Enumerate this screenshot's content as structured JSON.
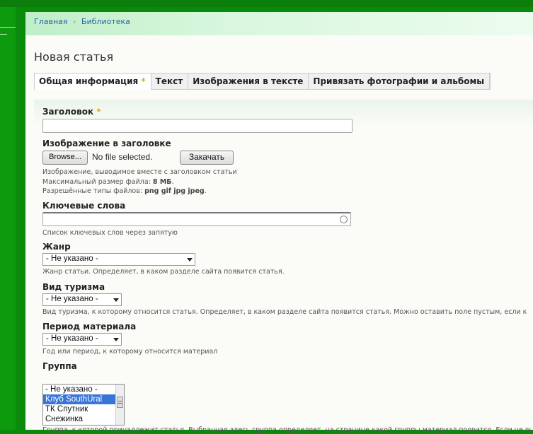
{
  "breadcrumb": [
    "Главная",
    "Библиотека"
  ],
  "breadcrumb_separator": "›",
  "page_title": "Новая статья",
  "tabs": [
    {
      "label": "Общая информация",
      "required": true,
      "active": true
    },
    {
      "label": "Текст"
    },
    {
      "label": "Изображения в тексте"
    },
    {
      "label": "Привязать фотографии и альбомы"
    }
  ],
  "required_mark": "*",
  "form": {
    "title": {
      "label": "Заголовок",
      "value": ""
    },
    "header_image": {
      "label": "Изображение в заголовке",
      "browse_label": "Browse...",
      "file_status": "No file selected.",
      "upload_label": "Закачать",
      "desc1": "Изображение, выводимое вместе с заголовком статьи",
      "desc2_prefix": "Максимальный размер файла: ",
      "desc2_value": "8 МБ",
      "desc2_suffix": ".",
      "desc3_prefix": "Разрешённые типы файлов: ",
      "desc3_value": "png gif jpg jpeg",
      "desc3_suffix": "."
    },
    "keywords": {
      "label": "Ключевые слова",
      "value": "",
      "desc": "Список ключевых слов через запятую"
    },
    "genre": {
      "label": "Жанр",
      "selected": "- Не указано -",
      "desc": "Жанр статьи. Определяет, в каком разделе сайта появится статья."
    },
    "tourism_type": {
      "label": "Вид туризма",
      "selected": "- Не указано -",
      "desc": "Вид туризма, к которому относится статья. Определяет, в каком разделе сайта появится статья. Можно оставить поле пустым, если к"
    },
    "period": {
      "label": "Период материала",
      "selected": "- Не указано -",
      "desc": "Год или период, к которому относится материал"
    },
    "group": {
      "label": "Группа",
      "options": [
        "- Не указано -",
        "Клуб SouthUral",
        "ТК Спутник",
        "Снежинка"
      ],
      "selected_index": 1,
      "desc": "Группа, к которой принадлежит статья. Выбранная здесь группа определяет, на странице какой группы материал появится. Если не вы"
    }
  },
  "colors": {
    "breadcrumb_link": "#2b63a6",
    "required": "#e3a41c",
    "background": "#0a8a0a",
    "selected_option": "#3875d7"
  },
  "icons": [
    "chevron-down-icon",
    "circle-icon",
    "scrollbar-thumb-icon"
  ]
}
